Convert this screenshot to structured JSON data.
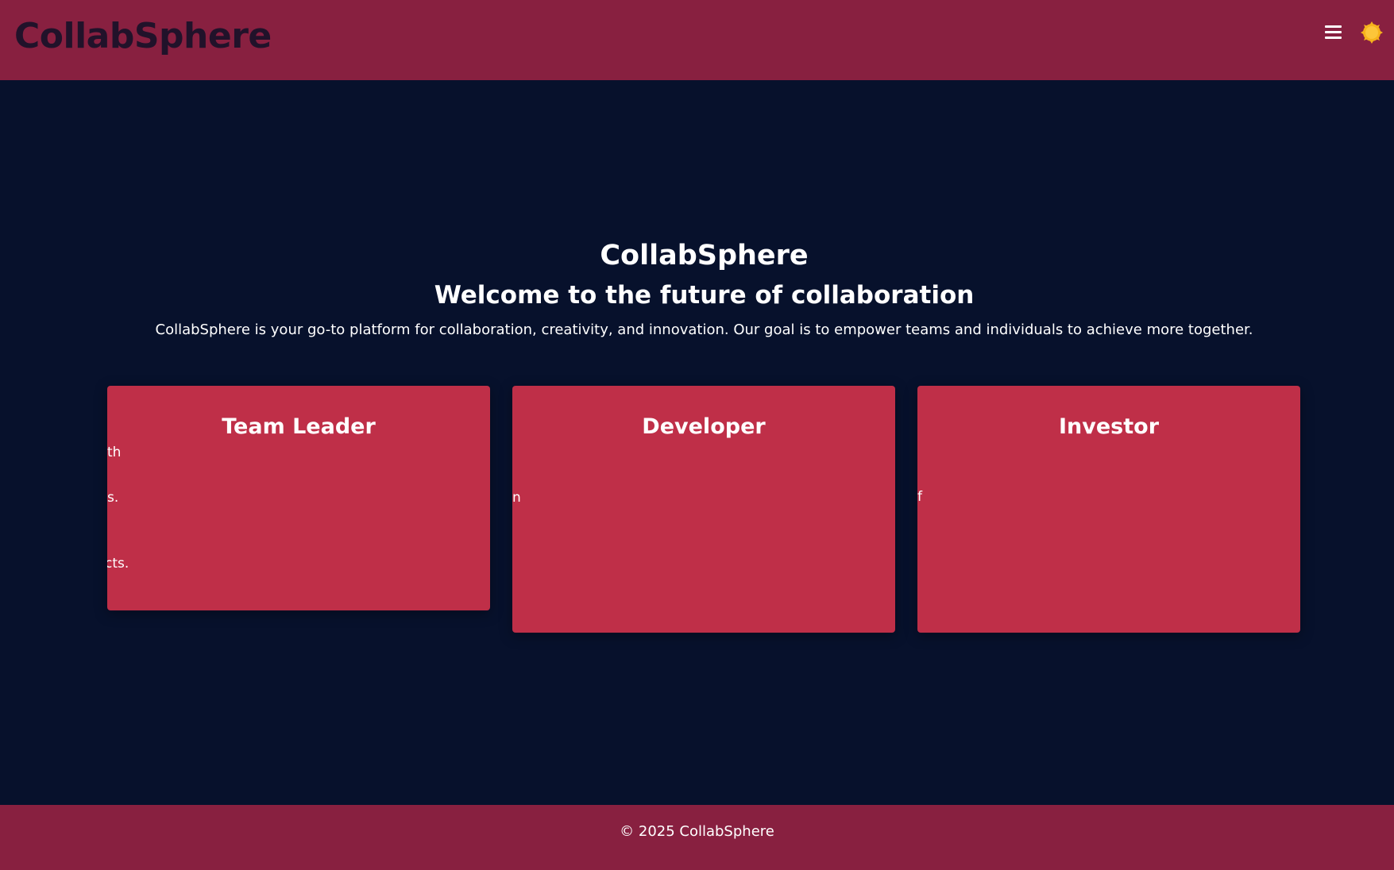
{
  "header": {
    "logo": "CollabSphere",
    "menu_icon": "hamburger-menu-icon",
    "theme_icon": "sun-icon"
  },
  "hero": {
    "title": "CollabSphere",
    "subtitle": "Welcome to the future of collaboration",
    "description": "CollabSphere is your go-to platform for collaboration, creativity, and innovation. Our goal is to empower teams and individuals to achieve more together."
  },
  "cards": [
    {
      "title": "Team Leader",
      "fragments": [
        "th",
        "s.",
        "cts."
      ]
    },
    {
      "title": "Developer",
      "fragments": [
        "n"
      ]
    },
    {
      "title": "Investor",
      "fragments": [
        "f"
      ]
    }
  ],
  "footer": {
    "copyright": "© 2025 CollabSphere"
  },
  "colors": {
    "header_bg": "#882040",
    "page_bg": "#07112c",
    "card_bg": "#bf2f48",
    "logo_text": "#21122a",
    "sun": "#f6b21c"
  }
}
